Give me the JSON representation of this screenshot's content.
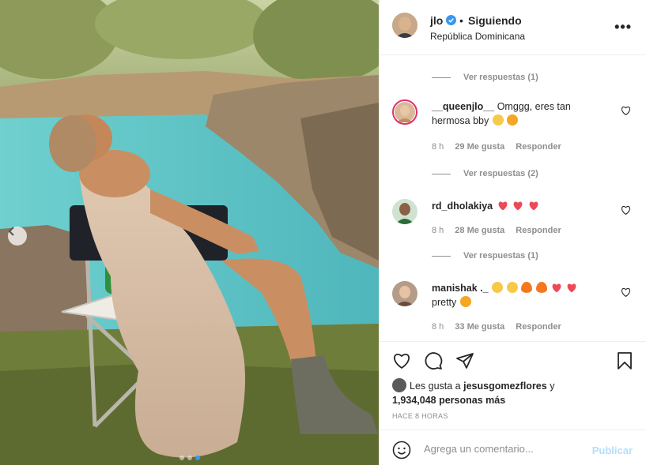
{
  "header": {
    "username": "jlo",
    "separator": "•",
    "follow_state": "Siguiendo",
    "location": "República Dominicana",
    "more_icon": "more-horizontal-icon"
  },
  "comments": {
    "view_replies_1": "Ver respuestas (1)",
    "items": [
      {
        "username": "__queenjlo__",
        "text": "Omggg, eres tan hermosa bby",
        "time": "8 h",
        "likes": "29 Me gusta",
        "reply": "Responder",
        "replies": "Ver respuestas (2)"
      },
      {
        "username": "rd_dholakiya",
        "text": "",
        "time": "8 h",
        "likes": "28 Me gusta",
        "reply": "Responder",
        "replies": "Ver respuestas (1)"
      },
      {
        "username": "manishak ._",
        "text": "pretty",
        "time": "8 h",
        "likes": "33 Me gusta",
        "reply": "Responder"
      }
    ]
  },
  "actions": {
    "likes_prefix": "Les gusta a",
    "liked_by": "jesusgomezflores",
    "likes_connector": "y",
    "others": "1,934,048 personas más",
    "timestamp": "HACE 8 HORAS"
  },
  "add_comment": {
    "placeholder": "Agrega un comentario...",
    "post_label": "Publicar"
  },
  "carousel": {
    "total": 3,
    "active": 3
  },
  "colors": {
    "accent": "#3897f0",
    "post_disabled": "#b2dffc",
    "heart_red": "#ed4956",
    "secondary_text": "#8e8e8e",
    "water": "#5fc3c4"
  }
}
